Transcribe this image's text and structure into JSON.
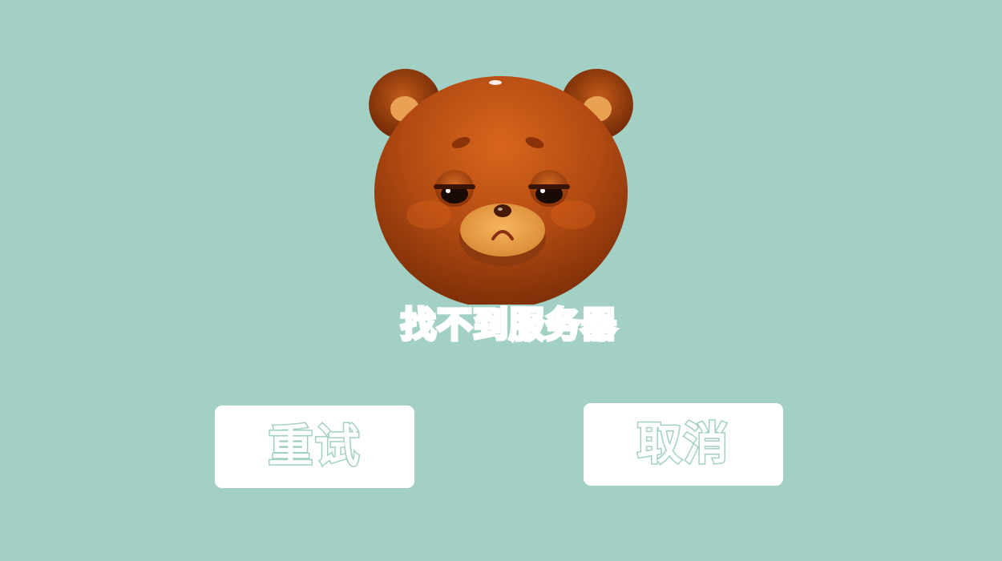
{
  "dialog": {
    "message": "找不到服务器",
    "retry_label": "重试",
    "cancel_label": "取消"
  },
  "mascot": {
    "icon": "sad-bear-face-icon"
  },
  "colors": {
    "background": "#a3d0c5",
    "button_bg": "#ffffff",
    "accent_text": "#a3d0c5",
    "bear_brown": "#c0551a"
  }
}
